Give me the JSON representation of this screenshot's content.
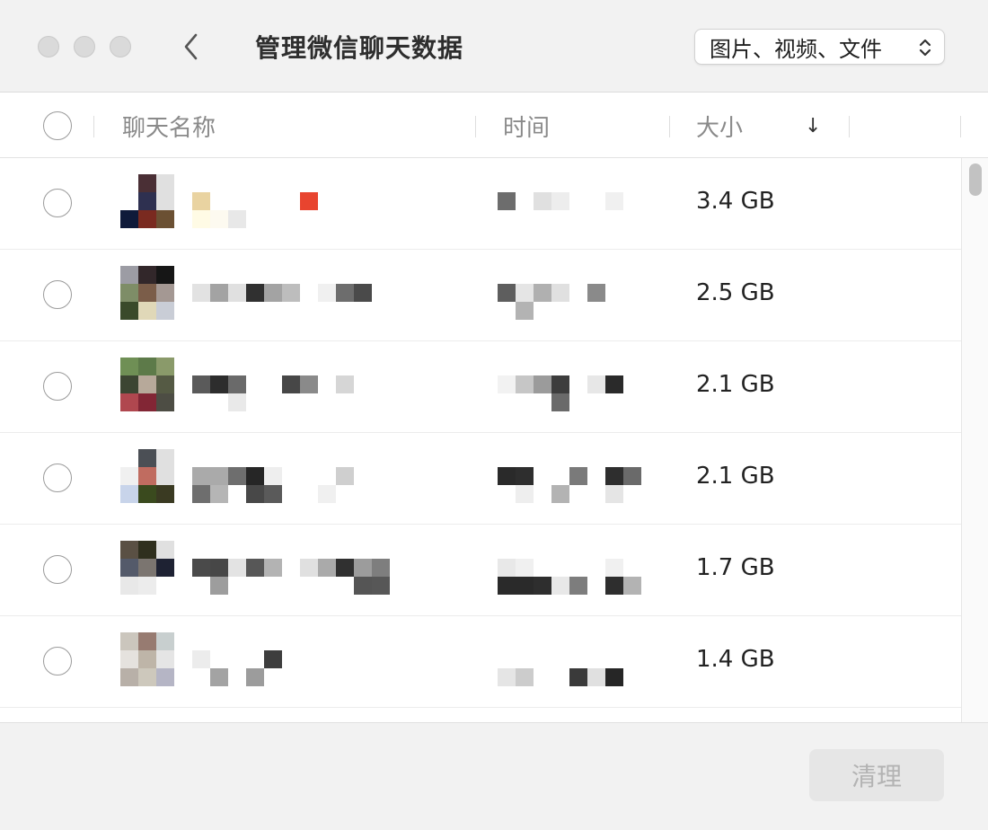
{
  "window": {
    "title": "管理微信聊天数据",
    "type_filter": "图片、视频、文件"
  },
  "columns": {
    "name": "聊天名称",
    "time": "时间",
    "size": "大小",
    "sort": "↓"
  },
  "rows": [
    {
      "size": "3.4 GB",
      "avatar": [
        "#ffffff",
        "#4a2f35",
        "#e0e0e0",
        "#ffffff",
        "#2e3050",
        "#e0e0e0",
        "#0f1a3a",
        "#7a2a20",
        "#6b5033"
      ],
      "name_blocks": [
        "#e9d3a1",
        "#fffbe5",
        "",
        "#fdfaf0",
        "",
        "#e8e8e8",
        "",
        "#ffffff",
        "",
        "",
        "",
        "",
        "#e8442f",
        ""
      ],
      "time_blocks": [
        "#6d6d6d",
        "",
        "",
        "",
        "#e0e0e0",
        "",
        "#ededed",
        "",
        "",
        "",
        " ",
        "",
        "#f0f0f0",
        ""
      ]
    },
    {
      "size": "2.5 GB",
      "avatar": [
        "#9c9ca4",
        "#32272a",
        "#161616",
        "#7e8d67",
        "#7b5d49",
        "#a49893",
        "#3a4a2a",
        "#e0d8b8",
        "#c9cdd6"
      ],
      "name_blocks": [
        "#e2e2e2",
        "",
        "#a3a3a3",
        "",
        "#e0e0e0",
        "",
        "#303030",
        "",
        "#a3a3a3",
        "",
        "#bdbdbd",
        "",
        "",
        "",
        "#f0f0f0",
        "",
        "#6d6d6d",
        "",
        "#4a4a4a",
        ""
      ],
      "time_blocks": [
        "#5e5e5e",
        "",
        "#e5e5e5",
        "#b3b3b3",
        "#b0b0b0",
        "",
        "#e0e0e0",
        "",
        "",
        "",
        "#8a8a8a",
        ""
      ]
    },
    {
      "size": "2.1 GB",
      "avatar": [
        "#6f8f55",
        "#5d7a49",
        "#8a9a6a",
        "#3c4532",
        "#b7a99a",
        "#555a44",
        "#b0474f",
        "#822635",
        "#4d4d44"
      ],
      "name_blocks": [
        "#5a5a5a",
        "",
        "#2d2d2d",
        "",
        "#6a6a6a",
        "#e9e9e9",
        "",
        "",
        "",
        "",
        "#474747",
        "",
        "#8a8a8a",
        "",
        "",
        "",
        "#d6d6d6",
        ""
      ],
      "time_blocks": [
        "#f2f2f2",
        "",
        "#c6c6c6",
        "",
        "#9b9b9b",
        "",
        "#3d3d3d",
        "#6a6a6a",
        "",
        "",
        "#e7e7e7",
        "",
        "#2a2a2a",
        ""
      ]
    },
    {
      "size": "2.1 GB",
      "avatar": [
        "#ffffff",
        "#4b4f55",
        "#e0e0e0",
        "#f0f0f0",
        "#c06c60",
        "#e0e0e0",
        "#c8d4ea",
        "#3a4a1e",
        "#3a3a22"
      ],
      "name_blocks": [
        "#aaaaaa",
        "#6e6e6e",
        "#aaaaaa",
        "#b5b5b5",
        "#6e6e6e",
        "",
        "#262626",
        "#484848",
        "#eeeeee",
        "#5a5a5a",
        "",
        "",
        "",
        "",
        "",
        "#f0f0f0",
        "#cfcfcf",
        ""
      ],
      "time_blocks": [
        "#2a2a2a",
        "",
        "#2e2e2e",
        "#eeeeee",
        "",
        "",
        "",
        "#b3b3b3",
        "#7a7a7a",
        "",
        "",
        "",
        "#2e2e2e",
        "#e5e5e5",
        "#6a6a6a",
        ""
      ]
    },
    {
      "size": "1.7 GB",
      "avatar": [
        "#5a5044",
        "#2f2f1e",
        "#e0e0e0",
        "#545a6a",
        "#7b7570",
        "#1e2233",
        "#e8e8e8",
        "#ececec",
        "#ffffff"
      ],
      "name_blocks": [
        "#4a4a4a",
        "",
        "#474747",
        "#9d9d9d",
        "#e3e3e3",
        "",
        "#575757",
        "",
        "#b3b3b3",
        "",
        "",
        "",
        "#e0e0e0",
        "",
        "#aaaaaa",
        "",
        "#303030",
        "",
        "#9c9c9c",
        "#555555",
        "#7e7e7e",
        "#575757"
      ],
      "time_blocks": [
        "#e8e8e8",
        "#2a2a2a",
        "#f0f0f0",
        "#2a2a2a",
        "",
        "#2e2e2e",
        "",
        "#e8e8e8",
        "",
        "#7d7d7d",
        "",
        "",
        "#f0f0f0",
        "#2e2e2e",
        "",
        "#b3b3b3"
      ]
    },
    {
      "size": "1.4 GB",
      "avatar": [
        "#cbc6bd",
        "#977b71",
        "#c8cfcf",
        "#e5e2de",
        "#beb5a8",
        "#e5e5e5",
        "#b8b0a8",
        "#cdc8bc",
        "#b5b5c5"
      ],
      "name_blocks": [
        "#ececec",
        "",
        "",
        "#a3a3a3",
        "",
        "",
        "",
        "#9c9c9c",
        "#3e3e3e",
        ""
      ],
      "time_blocks": [
        "",
        "#e5e5e5",
        "",
        "#cccccc",
        "",
        "",
        "",
        "",
        "",
        "#3a3a3a",
        "",
        "#e0e0e0",
        "",
        "#262626"
      ]
    }
  ]
}
